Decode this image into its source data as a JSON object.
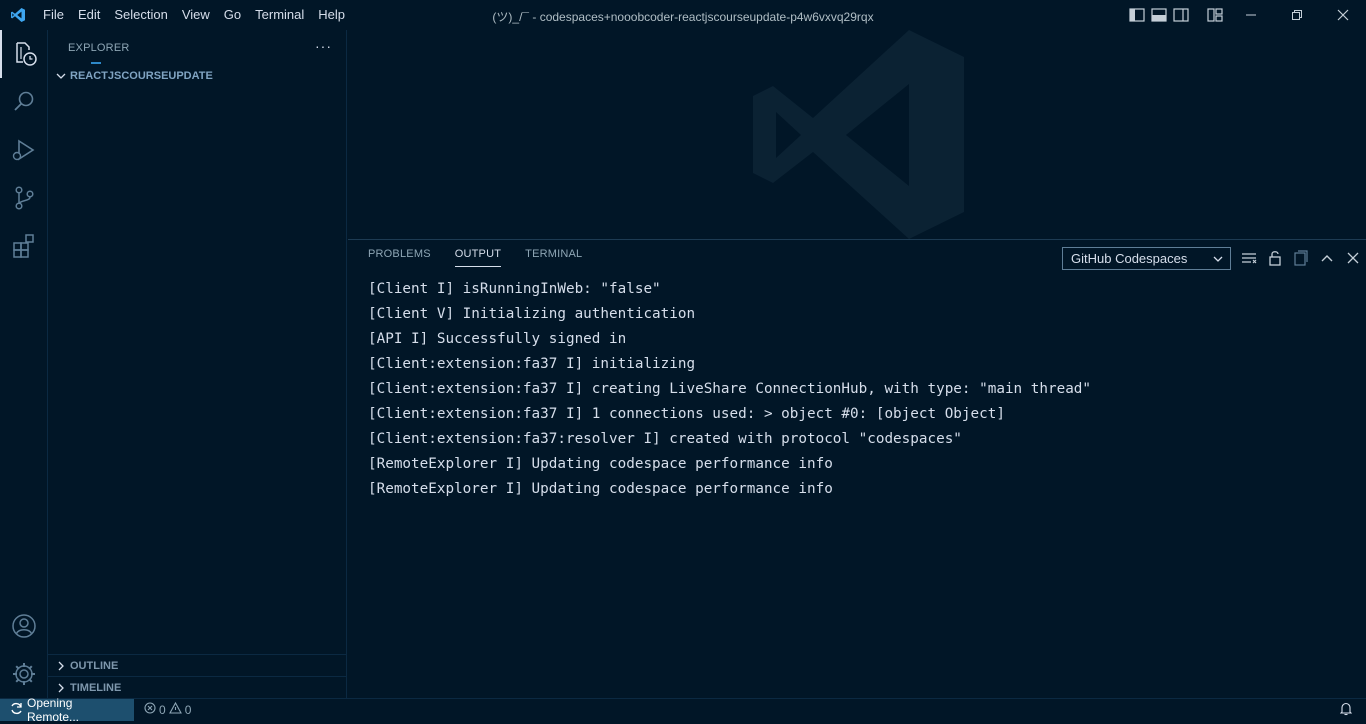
{
  "titlebar": {
    "menu": [
      "File",
      "Edit",
      "Selection",
      "View",
      "Go",
      "Terminal",
      "Help"
    ],
    "title": "(ツ)_/¯ - codespaces+nooobcoder-reactjscourseupdate-p4w6vxvq29rqx"
  },
  "sidebar": {
    "header": "EXPLORER",
    "root_folder": "REACTJSCOURSEUPDATE",
    "outline": "OUTLINE",
    "timeline": "TIMELINE"
  },
  "panel": {
    "tabs": [
      "PROBLEMS",
      "OUTPUT",
      "TERMINAL"
    ],
    "active_tab": "OUTPUT",
    "channel": "GitHub Codespaces",
    "lines": [
      "[Client I] isRunningInWeb: \"false\"",
      "[Client V] Initializing authentication",
      "[API I] Successfully signed in",
      "[Client:extension:fa37 I] initializing",
      "[Client:extension:fa37 I] creating LiveShare ConnectionHub, with type: \"main thread\"",
      "[Client:extension:fa37 I] 1 connections used: > object #0: [object Object]",
      "[Client:extension:fa37:resolver I] created with protocol \"codespaces\"",
      "[RemoteExplorer I] Updating codespace performance info",
      "[RemoteExplorer I] Updating codespace performance info"
    ]
  },
  "statusbar": {
    "remote": "Opening Remote...",
    "errors": "0",
    "warnings": "0"
  },
  "icons": {
    "activity": [
      "explorer-icon",
      "search-icon",
      "run-debug-icon",
      "source-control-icon",
      "extensions-icon",
      "account-icon",
      "settings-gear-icon"
    ]
  },
  "colors": {
    "background": "#011627",
    "foreground": "#d6deeb",
    "accent": "#1d4f6e"
  }
}
